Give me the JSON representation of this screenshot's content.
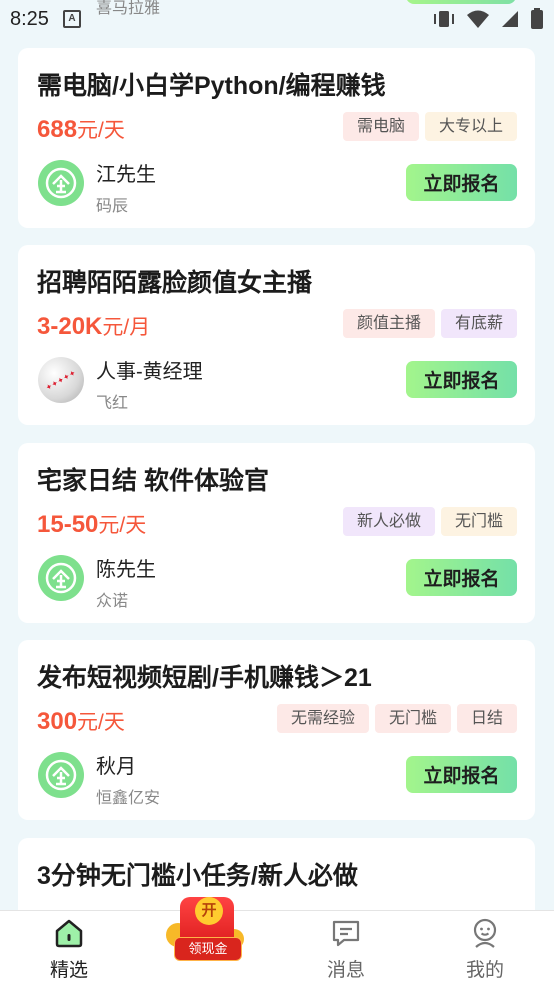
{
  "status": {
    "time": "8:25"
  },
  "peek": {
    "company": "喜马拉雅"
  },
  "jobs": [
    {
      "title": "需电脑/小白学Python/编程赚钱",
      "salary_num": "688",
      "salary_unit": "元/天",
      "tags": [
        {
          "text": "需电脑",
          "color": "red"
        },
        {
          "text": "大专以上",
          "color": "yellow"
        }
      ],
      "person": "江先生",
      "company": "码辰",
      "button": "立即报名",
      "avatar": "enterprise-icon"
    },
    {
      "title": "招聘陌陌露脸颜值女主播",
      "salary_num": "3-20K",
      "salary_unit": "元/月",
      "tags": [
        {
          "text": "颜值主播",
          "color": "red"
        },
        {
          "text": "有底薪",
          "color": "purple"
        }
      ],
      "person": "人事-黄经理",
      "company": "飞红",
      "button": "立即报名",
      "avatar": "photo"
    },
    {
      "title": "宅家日结 软件体验官",
      "salary_num": "15-50",
      "salary_unit": "元/天",
      "tags": [
        {
          "text": "新人必做",
          "color": "purple"
        },
        {
          "text": "无门槛",
          "color": "yellow"
        }
      ],
      "person": "陈先生",
      "company": "众诺",
      "button": "立即报名",
      "avatar": "enterprise-icon"
    },
    {
      "title": "发布短视频短剧/手机赚钱＞21",
      "salary_num": "300",
      "salary_unit": "元/天",
      "tags": [
        {
          "text": "无需经验",
          "color": "red"
        },
        {
          "text": "无门槛",
          "color": "red"
        },
        {
          "text": "日结",
          "color": "red"
        }
      ],
      "person": "秋月",
      "company": "恒鑫亿安",
      "button": "立即报名",
      "avatar": "enterprise-icon"
    },
    {
      "title": "3分钟无门槛小任务/新人必做"
    }
  ],
  "nav": {
    "home": "精选",
    "cash_coin": "开",
    "cash_label": "领现金",
    "messages": "消息",
    "mine": "我的"
  },
  "colors": {
    "accent_green": "#7ee08d",
    "salary_red": "#f5573b",
    "button_gradient": [
      "#a3f58c",
      "#74e0a8"
    ]
  }
}
